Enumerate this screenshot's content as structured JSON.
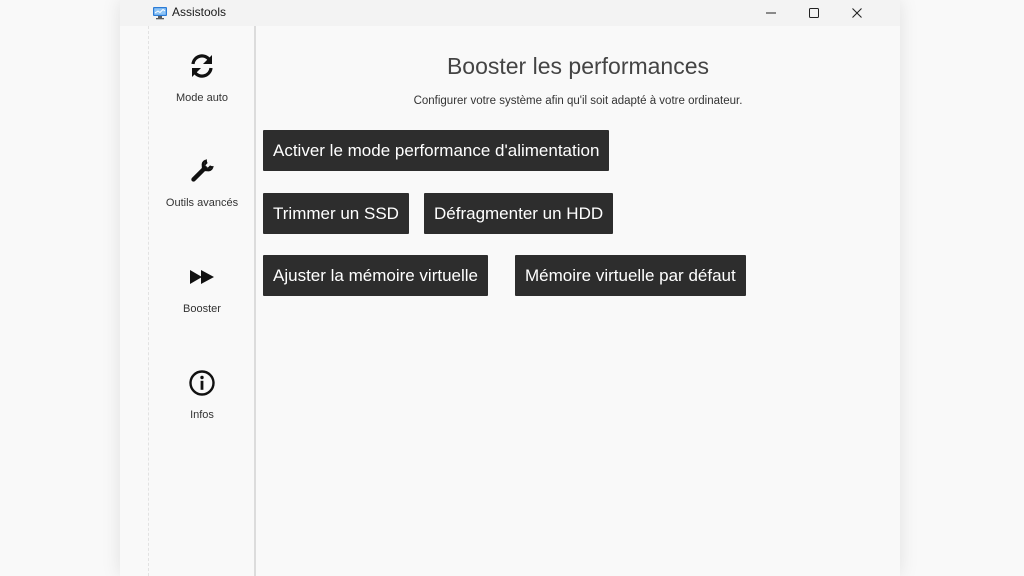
{
  "window": {
    "title": "Assistools",
    "app_icon": "monitor-icon",
    "controls": [
      "minimize-icon",
      "maximize-icon",
      "close-icon"
    ]
  },
  "sidebar": {
    "items": [
      {
        "label": "Mode auto",
        "icon": "refresh-icon"
      },
      {
        "label": "Outils avancés",
        "icon": "wrench-icon"
      },
      {
        "label": "Booster",
        "icon": "fast-forward-icon"
      },
      {
        "label": "Infos",
        "icon": "info-icon"
      }
    ]
  },
  "main": {
    "title": "Booster les performances",
    "subtitle": "Configurer votre système afin qu'il soit adapté à votre ordinateur.",
    "buttons": {
      "power_mode": "Activer le mode performance d'alimentation",
      "trim_ssd": "Trimmer un SSD",
      "defrag_hdd": "Défragmenter un HDD",
      "adjust_vmem": "Ajuster la mémoire virtuelle",
      "default_vmem": "Mémoire virtuelle par défaut"
    }
  },
  "colors": {
    "button_bg": "#2d2d2d",
    "button_text": "#ffffff",
    "background": "#f9f9f9",
    "title_text": "#444444"
  }
}
